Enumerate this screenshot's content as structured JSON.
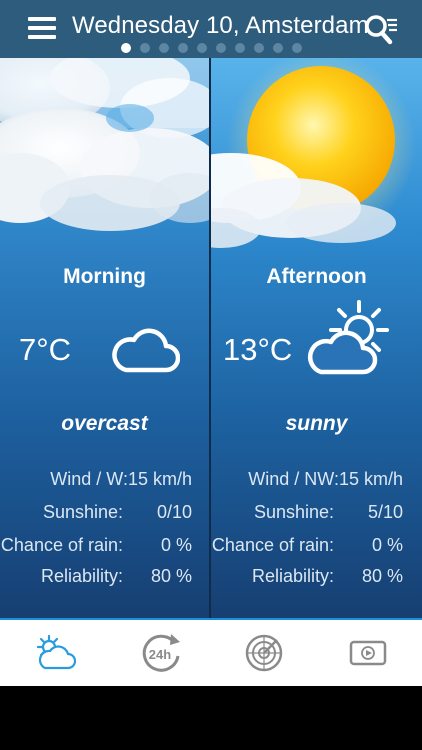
{
  "header": {
    "title": "Wednesday 10, Amsterdam",
    "page_count": 10,
    "active_page": 0
  },
  "forecast": [
    {
      "period": "Morning",
      "temperature": "7°C",
      "condition": "overcast",
      "icon": "cloud-icon",
      "wind": "Wind / W:15 km/h",
      "sunshine_label": "Sunshine:",
      "sunshine_value": "0/10",
      "rain_label": "Chance of rain:",
      "rain_value": "0 %",
      "reliability_label": "Reliability:",
      "reliability_value": "80 %"
    },
    {
      "period": "Afternoon",
      "temperature": "13°C",
      "condition": "sunny",
      "icon": "sun-behind-cloud-icon",
      "wind": "Wind / NW:15 km/h",
      "sunshine_label": "Sunshine:",
      "sunshine_value": "5/10",
      "rain_label": "Chance of rain:",
      "rain_value": "0 %",
      "reliability_label": "Reliability:",
      "reliability_value": "80 %"
    }
  ],
  "tabs": [
    {
      "icon": "weather-icon",
      "active": true
    },
    {
      "icon": "24h-forecast-icon",
      "active": false
    },
    {
      "icon": "radar-icon",
      "active": false
    },
    {
      "icon": "video-icon",
      "active": false
    }
  ],
  "colors": {
    "header": "#2e5c7c",
    "accent": "#1e8fd6",
    "text": "#ffffff",
    "subtext": "#dbe7f2"
  }
}
